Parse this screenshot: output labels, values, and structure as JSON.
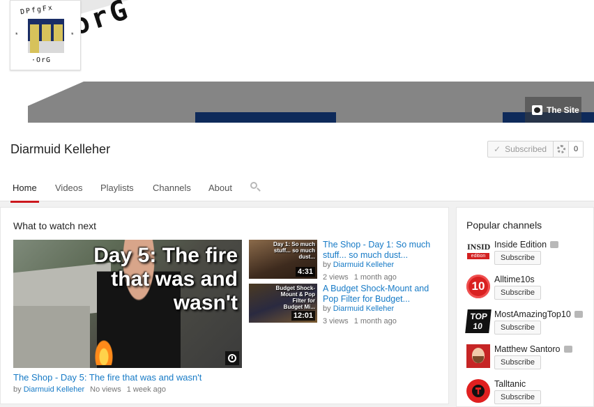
{
  "banner": {
    "avatar_text_top": "DPfgFx",
    "avatar_text_bottom": "·OrG",
    "avatar_stars": "*",
    "banner_logo_text": "orG",
    "site_link_label": "The Site"
  },
  "channel": {
    "name": "Diarmuid Kelleher",
    "subscribed_label": "Subscribed",
    "subscriber_count": "0"
  },
  "tabs": [
    {
      "label": "Home",
      "active": true
    },
    {
      "label": "Videos",
      "active": false
    },
    {
      "label": "Playlists",
      "active": false
    },
    {
      "label": "Channels",
      "active": false
    },
    {
      "label": "About",
      "active": false
    }
  ],
  "main": {
    "heading": "What to watch next",
    "by_label": "by",
    "featured": {
      "overlay_text": "Day 5: The fire that was and wasn't",
      "title": "The Shop - Day 5: The fire that was and wasn't",
      "author": "Diarmuid Kelleher",
      "views": "No views",
      "age": "1 week ago"
    },
    "videos": [
      {
        "overlay_text": "Day 1: So much stuff... so much dust...",
        "duration": "4:31",
        "title": "The Shop - Day 1: So much stuff... so much dust...",
        "author": "Diarmuid Kelleher",
        "views": "2 views",
        "age": "1 month ago"
      },
      {
        "overlay_text": "Budget Shock-Mount & Pop Filter for Budget Mi...",
        "duration": "12:01",
        "title": "A Budget Shock-Mount and Pop Filter for Budget...",
        "author": "Diarmuid Kelleher",
        "views": "3 views",
        "age": "1 month ago"
      }
    ]
  },
  "sidebar": {
    "heading": "Popular channels",
    "subscribe_label": "Subscribe",
    "channels": [
      {
        "name": "Inside Edition",
        "avatar_text_1": "INSIDE",
        "avatar_text_2": "edition"
      },
      {
        "name": "Alltime10s",
        "avatar_text_1": "10"
      },
      {
        "name": "MostAmazingTop10",
        "avatar_text_1": "TOP",
        "avatar_text_2": "10"
      },
      {
        "name": "Matthew Santoro"
      },
      {
        "name": "Talltanic"
      }
    ]
  },
  "colors": {
    "link_blue": "#167ac6",
    "active_tab_red": "#cc181e",
    "banner_navy": "#0e2a5a"
  }
}
